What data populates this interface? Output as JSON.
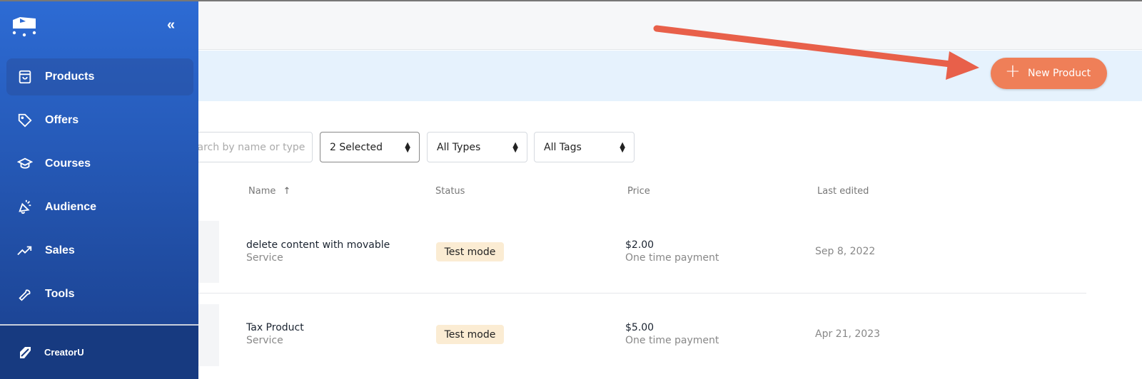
{
  "sidebar": {
    "items": [
      {
        "label": "Products",
        "icon": "shopping-bag-icon",
        "active": true
      },
      {
        "label": "Offers",
        "icon": "tag-icon"
      },
      {
        "label": "Courses",
        "icon": "graduation-cap-icon"
      },
      {
        "label": "Audience",
        "icon": "megaphone-icon"
      },
      {
        "label": "Sales",
        "icon": "trending-up-icon"
      },
      {
        "label": "Tools",
        "icon": "wrench-icon"
      }
    ],
    "collapse_label": "«",
    "footer": {
      "label": "CreatorU",
      "icon": "creatoru-logo-icon"
    }
  },
  "header": {
    "new_product_label": "New Product",
    "plus": "+"
  },
  "filters": {
    "search_placeholder": "Search by name or type",
    "status": "2 Selected",
    "types": "All Types",
    "tags": "All Tags"
  },
  "table": {
    "columns": {
      "name": "Name",
      "sort": "↑",
      "status": "Status",
      "price": "Price",
      "last_edited": "Last edited"
    },
    "rows": [
      {
        "name": "delete content with movable",
        "type": "Service",
        "status": "Test mode",
        "price": "$2.00",
        "payment": "One time payment",
        "date": "Sep 8, 2022"
      },
      {
        "name": "Tax Product",
        "type": "Service",
        "status": "Test mode",
        "price": "$5.00",
        "payment": "One time payment",
        "date": "Apr 21, 2023"
      }
    ]
  },
  "colors": {
    "accent": "#ef7f58",
    "sidebar": "#2d6bd4",
    "annotation_arrow": "#e8604a",
    "badge": "#fbecd3"
  }
}
